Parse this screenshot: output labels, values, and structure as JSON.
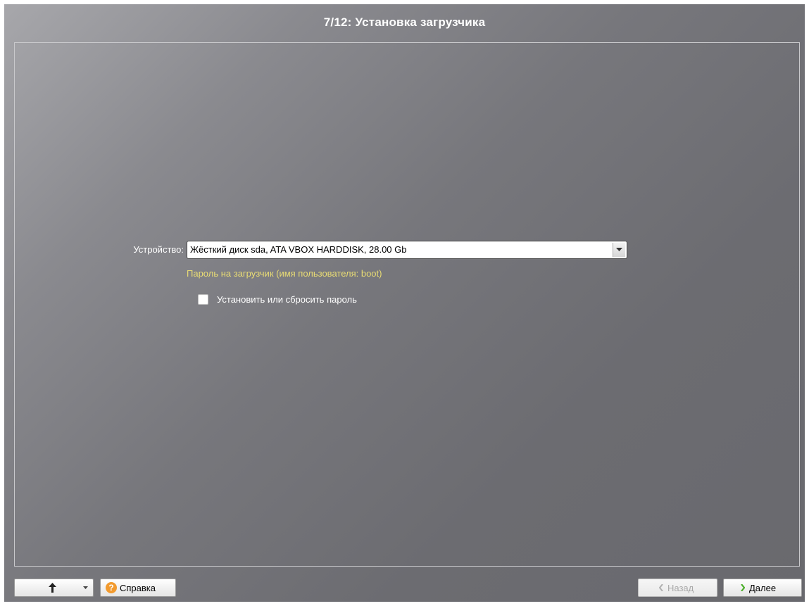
{
  "window": {
    "title": "7/12: Установка загрузчика"
  },
  "form": {
    "device_label": "Устройство:",
    "device_value": "Жёсткий диск sda, ATA VBOX HARDDISK, 28.00 Gb",
    "password_section_label": "Пароль на загрузчик (имя пользователя: boot)",
    "checkbox_label": "Установить или сбросить пароль",
    "checkbox_checked": false
  },
  "footer": {
    "up_button_icon": "arrow-up-icon",
    "help_label": "Справка",
    "help_icon": "question-icon",
    "back_label": "Назад",
    "back_enabled": false,
    "next_label": "Далее"
  },
  "colors": {
    "accent_text": "#e9dc74",
    "next_chevron": "#4caf2a",
    "help_icon_bg": "#f29a2e"
  }
}
